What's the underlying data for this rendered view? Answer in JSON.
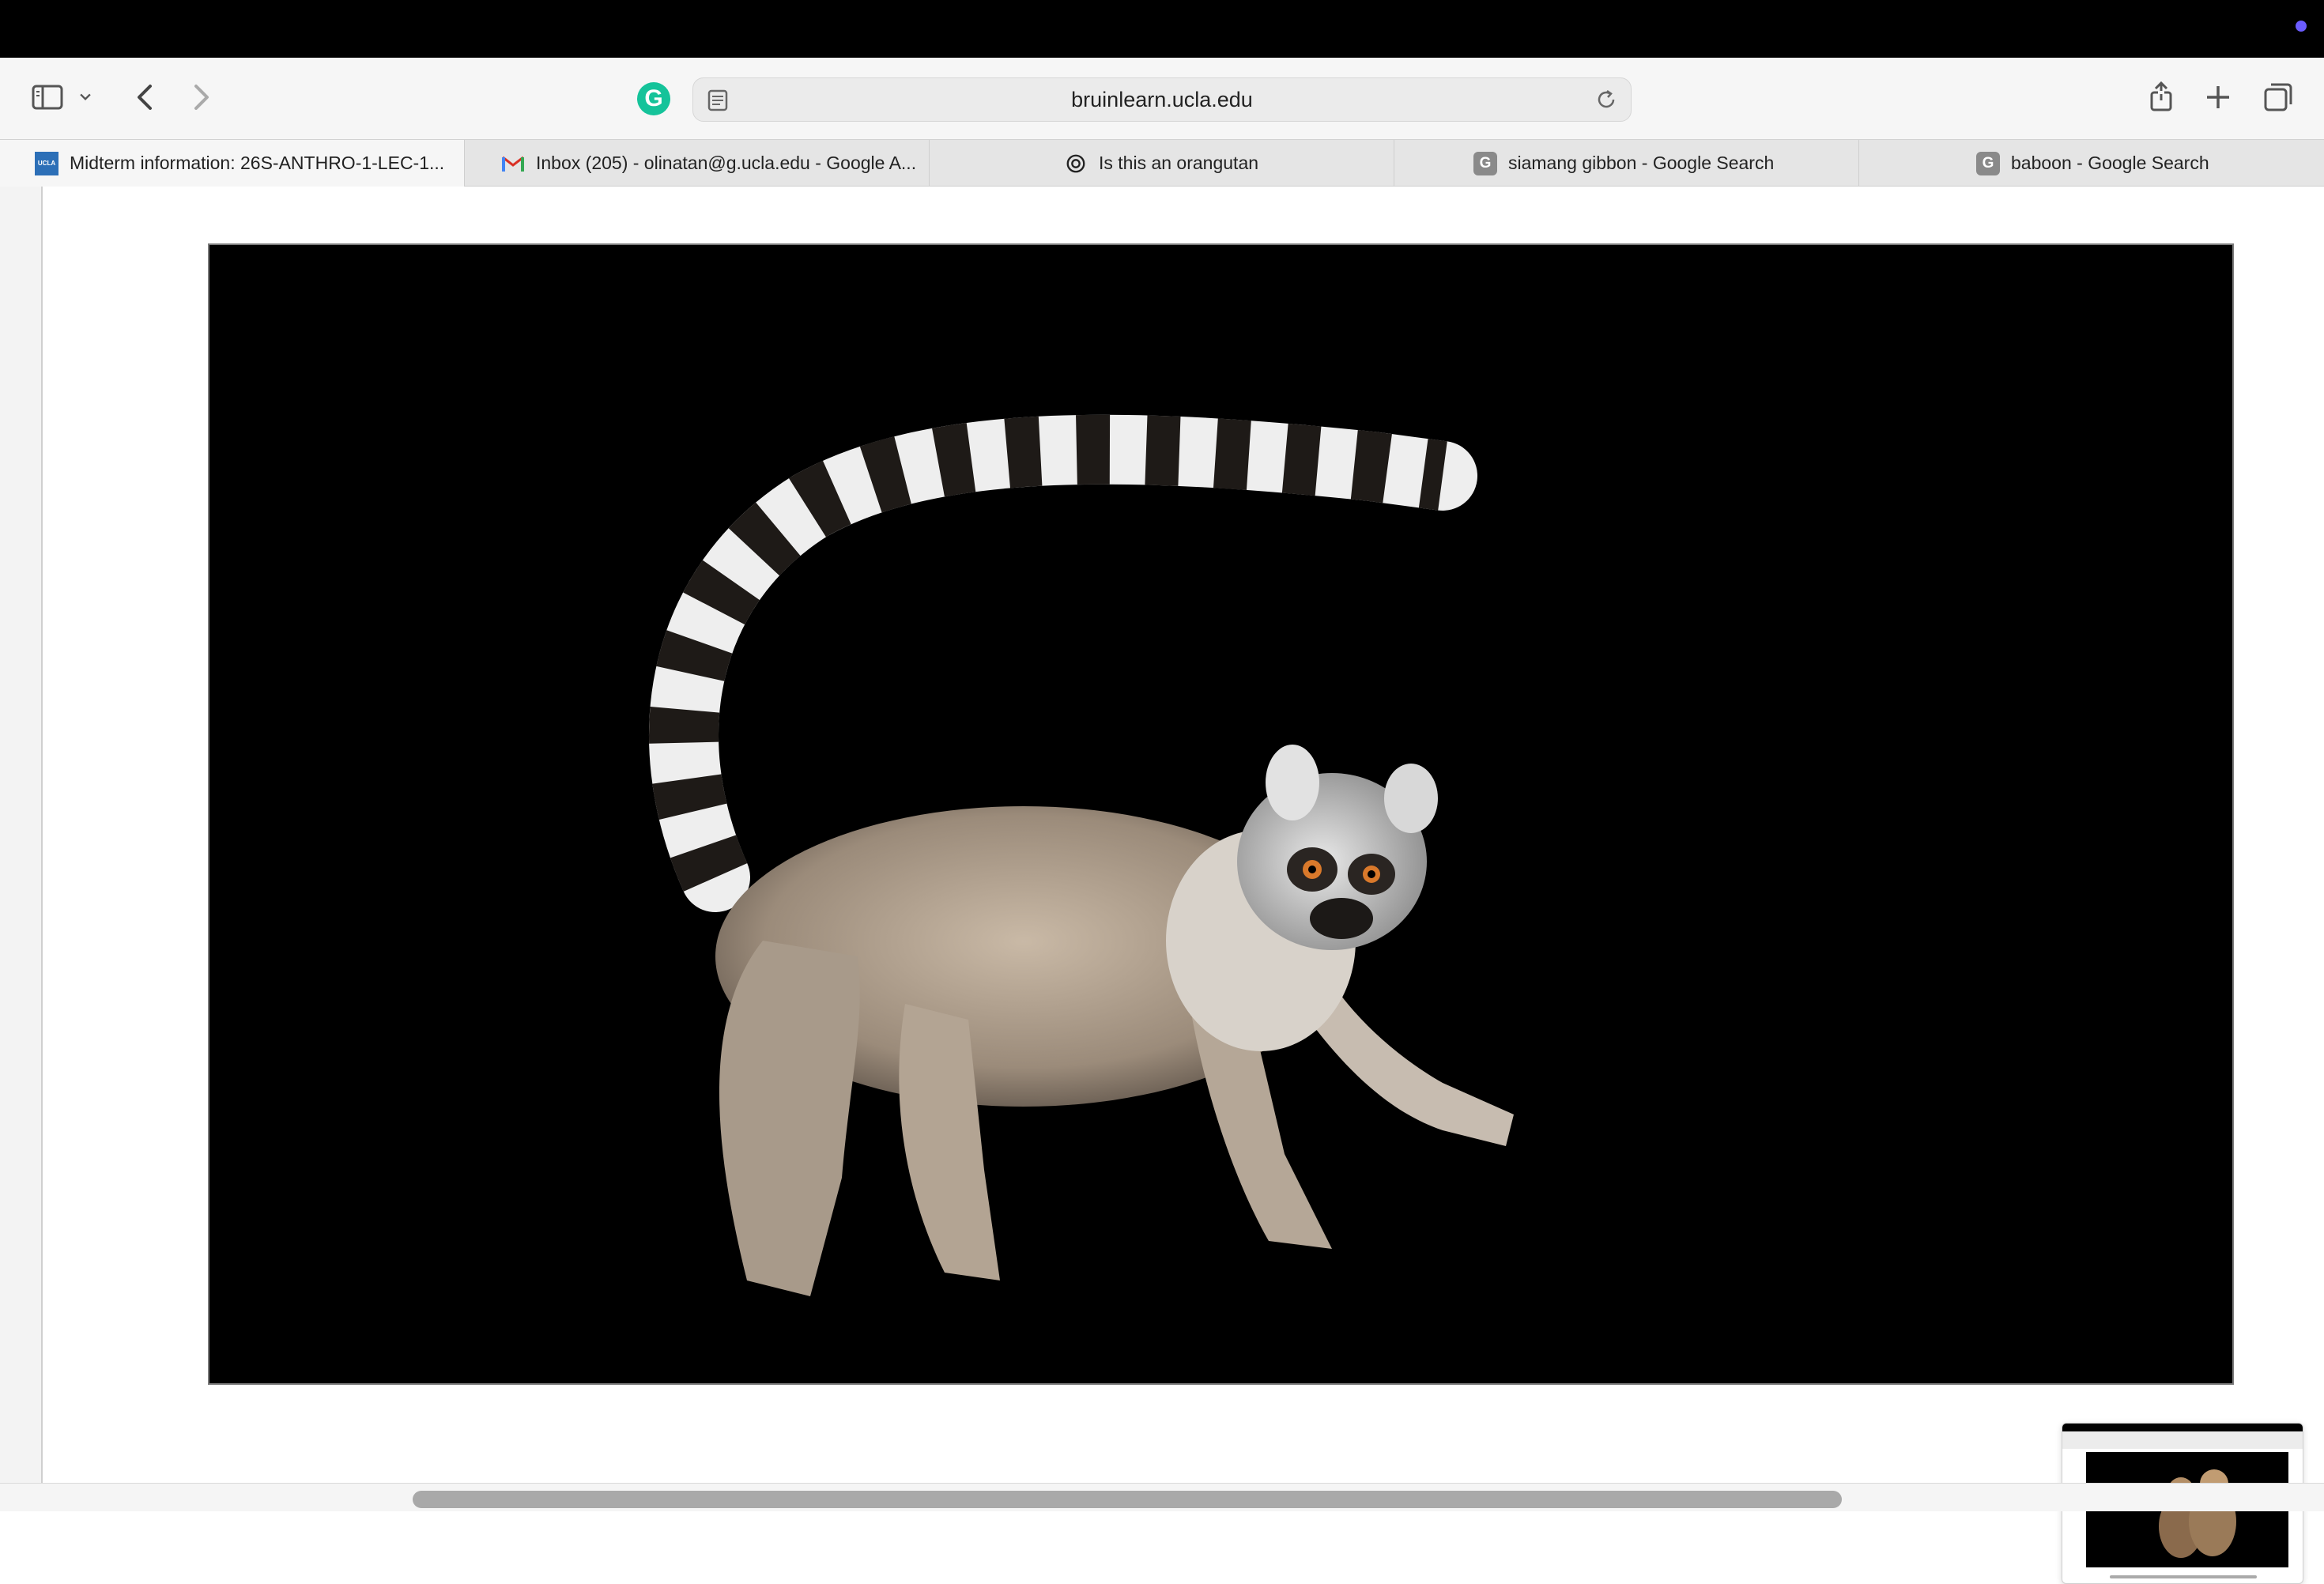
{
  "browser": {
    "url": "bruinlearn.ucla.edu",
    "tabs": [
      {
        "title": "Midterm information: 26S-ANTHRO-1-LEC-1...",
        "favicon": "ucla-icon",
        "favicon_text": "UCLA",
        "active": true
      },
      {
        "title": "Inbox (205) - olinatan@g.ucla.edu - Google A...",
        "favicon": "gmail-icon",
        "active": false
      },
      {
        "title": "Is this an orangutan",
        "favicon": "chatgpt-icon",
        "active": false
      },
      {
        "title": "siamang gibbon - Google Search",
        "favicon": "google-icon",
        "favicon_text": "G",
        "active": false
      },
      {
        "title": "baboon - Google Search",
        "favicon": "google-icon",
        "favicon_text": "G",
        "active": false
      }
    ],
    "toolbar_icons": [
      "sidebar-icon",
      "chevron-down-icon",
      "back-icon",
      "forward-icon",
      "grammarly-icon",
      "reader-icon",
      "reload-icon",
      "share-icon",
      "new-tab-icon",
      "tab-overview-icon"
    ],
    "grammarly_letter": "G"
  },
  "content": {
    "image_subject": "ring-tailed lemur on black background",
    "pip_subject": "monkeys thumbnail preview"
  },
  "colors": {
    "accent_dot": "#6b5cff",
    "grammarly": "#15c39a"
  }
}
